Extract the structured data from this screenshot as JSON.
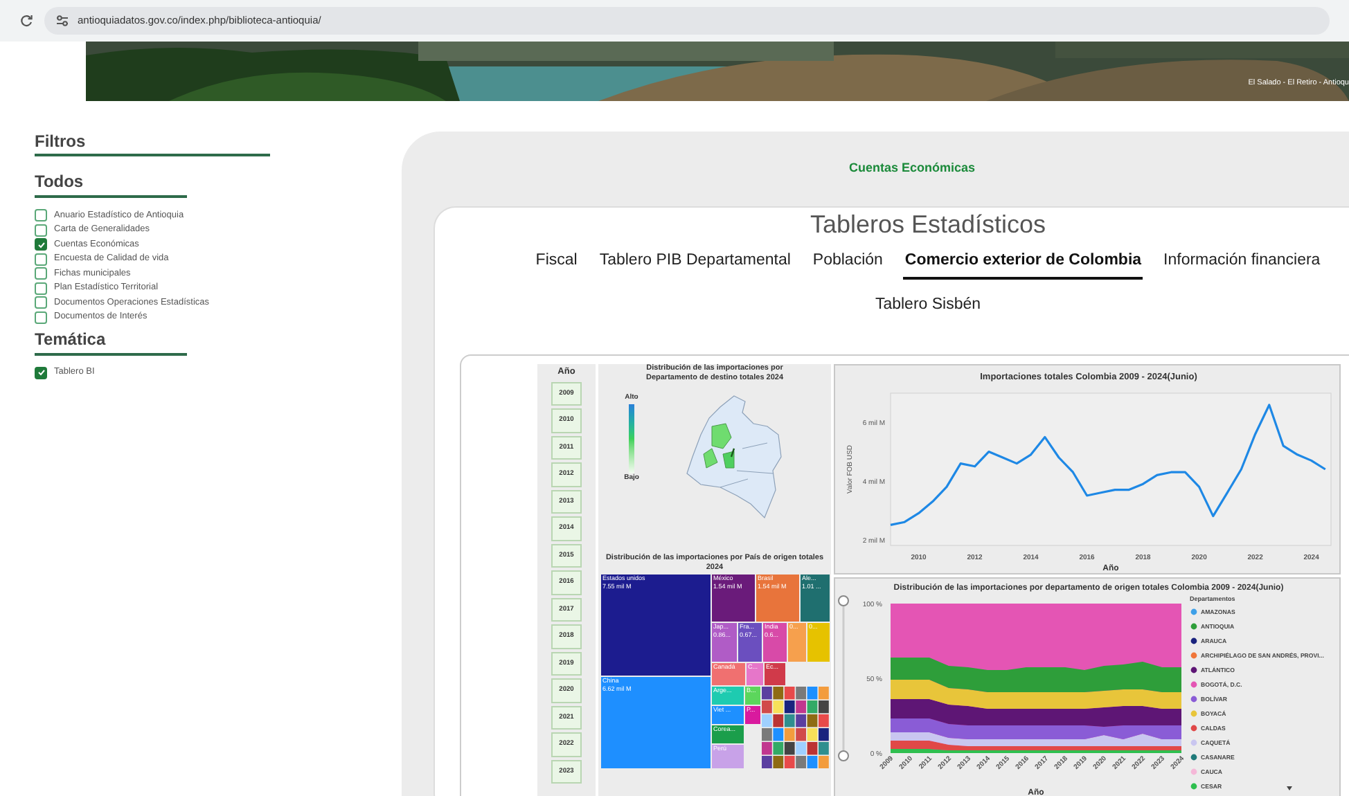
{
  "browser": {
    "url": "antioquiadatos.gov.co/index.php/biblioteca-antioquia/"
  },
  "banner": {
    "caption": "El Salado - El Retiro - Antioqu"
  },
  "sidebar": {
    "title": "Filtros",
    "groups": [
      {
        "title": "Todos",
        "items": [
          {
            "label": "Anuario Estadístico de Antioquia",
            "checked": false
          },
          {
            "label": "Carta de Generalidades",
            "checked": false
          },
          {
            "label": "Cuentas Económicas",
            "checked": true
          },
          {
            "label": "Encuesta de Calidad de vida",
            "checked": false
          },
          {
            "label": "Fichas municipales",
            "checked": false
          },
          {
            "label": "Plan Estadístico Territorial",
            "checked": false
          },
          {
            "label": "Documentos Operaciones Estadísticas",
            "checked": false
          },
          {
            "label": "Documentos de Interés",
            "checked": false
          }
        ]
      },
      {
        "title": "Temática",
        "items": [
          {
            "label": "Tablero BI",
            "checked": true
          }
        ]
      }
    ]
  },
  "main": {
    "category": "Cuentas Económicas",
    "title": "Tableros Estadísticos",
    "tabs": [
      {
        "label": "Fiscal",
        "selected": false
      },
      {
        "label": "Tablero PIB Departamental",
        "selected": false
      },
      {
        "label": "Población",
        "selected": false
      },
      {
        "label": "Comercio exterior de Colombia",
        "selected": true
      },
      {
        "label": "Información financiera",
        "selected": false
      },
      {
        "label": "Tablero Sisbén",
        "selected": false
      }
    ],
    "dashboard": {
      "year_filter": {
        "title": "Año",
        "years": [
          "2009",
          "2010",
          "2011",
          "2012",
          "2013",
          "2014",
          "2015",
          "2016",
          "2017",
          "2018",
          "2019",
          "2020",
          "2021",
          "2022",
          "2023"
        ]
      },
      "map": {
        "title": "Distribución de las importaciones por Departamento de destino totales 2024",
        "legend_high": "Alto",
        "legend_low": "Bajo"
      },
      "treemap": {
        "title": "Distribución de las importaciones por País de origen totales 2024",
        "tiles": [
          {
            "label": "Estados unidos",
            "value": "7.55 mil M",
            "color": "#1c1c8f"
          },
          {
            "label": "China",
            "value": "6.62 mil M",
            "color": "#1e8fff"
          },
          {
            "label": "México",
            "value": "1.54 mil M",
            "color": "#6a1b7a"
          },
          {
            "label": "Brasil",
            "value": "1.54 mil M",
            "color": "#e8743b"
          },
          {
            "label": "Ale...",
            "value": "1.01 ...",
            "color": "#1f6f6f"
          },
          {
            "label": "Jap...",
            "value": "0.86...",
            "color": "#b05cc6"
          },
          {
            "label": "Fra...",
            "value": "0.67...",
            "color": "#6b4fbf"
          },
          {
            "label": "India",
            "value": "0.6...",
            "color": "#d84aa8"
          },
          {
            "value": "0...",
            "color": "#f6a04d"
          },
          {
            "value": "0...",
            "color": "#e6c200"
          },
          {
            "label": "Canadá",
            "color": "#f07070"
          },
          {
            "label": "C...",
            "color": "#e676c9"
          },
          {
            "label": "Ec...",
            "color": "#d03a4a"
          },
          {
            "label": "Arge...",
            "color": "#1ecbb0"
          },
          {
            "label": "B...",
            "color": "#5cd65c"
          },
          {
            "label": "Viet ...",
            "color": "#1e90ff"
          },
          {
            "label": "P...",
            "color": "#d91a9e"
          },
          {
            "label": "Corea...",
            "color": "#1b9e4b"
          },
          {
            "label": "Perú",
            "color": "#c8a2e8"
          }
        ]
      },
      "line_chart": {
        "chart_data": {
          "type": "line",
          "title": "Importaciones totales Colombia 2009 - 2024(Junio)",
          "xlabel": "Año",
          "ylabel": "Valor FOB USD",
          "x": [
            2009,
            2009.5,
            2010,
            2010.5,
            2011,
            2011.5,
            2012,
            2012.5,
            2013,
            2013.5,
            2014,
            2014.5,
            2015,
            2015.5,
            2016,
            2016.5,
            2017,
            2017.5,
            2018,
            2018.5,
            2019,
            2019.5,
            2020,
            2020.5,
            2021,
            2021.5,
            2022,
            2022.5,
            2023,
            2023.5,
            2024,
            2024.5
          ],
          "series": [
            {
              "color": "#1e88e5",
              "values": [
                2.5,
                2.6,
                2.9,
                3.3,
                3.8,
                4.6,
                4.5,
                5.0,
                4.8,
                4.6,
                4.9,
                5.5,
                4.8,
                4.3,
                3.5,
                3.6,
                3.7,
                3.7,
                3.9,
                4.2,
                4.3,
                4.3,
                3.8,
                2.8,
                3.6,
                4.4,
                5.6,
                6.6,
                5.2,
                4.9,
                4.7,
                4.4
              ]
            }
          ],
          "xlim": [
            2009,
            2024.7
          ],
          "ylim": [
            1.8,
            7
          ],
          "xticks": [
            2010,
            2012,
            2014,
            2016,
            2018,
            2020,
            2022,
            2024
          ],
          "yticks": [
            {
              "value": 2,
              "label": "2 mil M"
            },
            {
              "value": 4,
              "label": "4 mil M"
            },
            {
              "value": 6,
              "label": "6 mil M"
            }
          ]
        }
      },
      "share_chart": {
        "range_slider": {
          "level": 1
        },
        "title": "Distribución de las importaciones por departamento de origen totales Colombia 2009 - 2024(Junio)",
        "yticks": [
          "100 %",
          "50 %",
          "0 %"
        ],
        "years": [
          "2009",
          "2010",
          "2011",
          "2012",
          "2013",
          "2014",
          "2015",
          "2016",
          "2017",
          "2018",
          "2019",
          "2020",
          "2021",
          "2022",
          "2023",
          "2024"
        ],
        "xlabel": "Año",
        "legend_title": "Departamentos",
        "legend": [
          {
            "label": "AMAZONAS",
            "color": "#3ea0e8"
          },
          {
            "label": "ANTIOQUIA",
            "color": "#2e9e3a"
          },
          {
            "label": "ARAUCA",
            "color": "#1a237e"
          },
          {
            "label": "ARCHIPIÉLAGO DE SAN ANDRÉS, PROVI...",
            "color": "#f0763a"
          },
          {
            "label": "ATLÁNTICO",
            "color": "#5e1675"
          },
          {
            "label": "BOGOTÁ, D.C.",
            "color": "#e455b4"
          },
          {
            "label": "BOLÍVAR",
            "color": "#8a5cd6"
          },
          {
            "label": "BOYACÁ",
            "color": "#e8c53a"
          },
          {
            "label": "CALDAS",
            "color": "#e04848"
          },
          {
            "label": "CAQUETÁ",
            "color": "#c9c6f0"
          },
          {
            "label": "CASANARE",
            "color": "#1f7a7a"
          },
          {
            "label": "CAUCA",
            "color": "#f5b8d8"
          },
          {
            "label": "CESAR",
            "color": "#2fbf4f"
          }
        ]
      }
    }
  }
}
